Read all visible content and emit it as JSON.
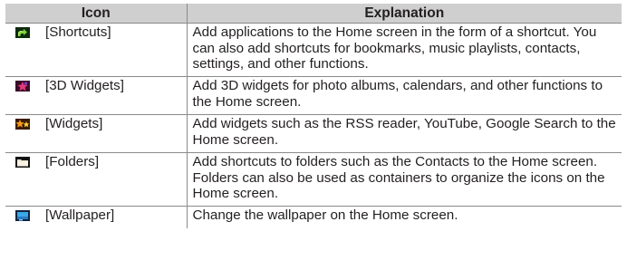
{
  "table": {
    "headers": {
      "icon": "Icon",
      "explanation": "Explanation"
    },
    "rows": [
      {
        "icon_name": "shortcut-arrow-icon",
        "label": "[Shortcuts]",
        "explanation": "Add applications to the Home screen in the form of a shortcut. You can also add shortcuts for bookmarks, music playlists, contacts, settings, and other functions."
      },
      {
        "icon_name": "3d-widget-icon",
        "label": "[3D Widgets]",
        "explanation": "Add 3D widgets for photo albums, calendars, and other functions to the Home screen."
      },
      {
        "icon_name": "widget-icon",
        "label": "[Widgets]",
        "explanation": "Add widgets such as the RSS reader, YouTube, Google Search to the Home screen."
      },
      {
        "icon_name": "folder-icon",
        "label": "[Folders]",
        "explanation": "Add shortcuts to folders such as the Contacts to the Home screen. Folders can also be used as containers to organize the icons on the Home screen."
      },
      {
        "icon_name": "wallpaper-icon",
        "label": "[Wallpaper]",
        "explanation": "Change the wallpaper on the Home screen."
      }
    ]
  },
  "colors": {
    "header_background": "#cfcfcf",
    "grid_lines": "#8a8a8a",
    "text": "#231f20"
  }
}
